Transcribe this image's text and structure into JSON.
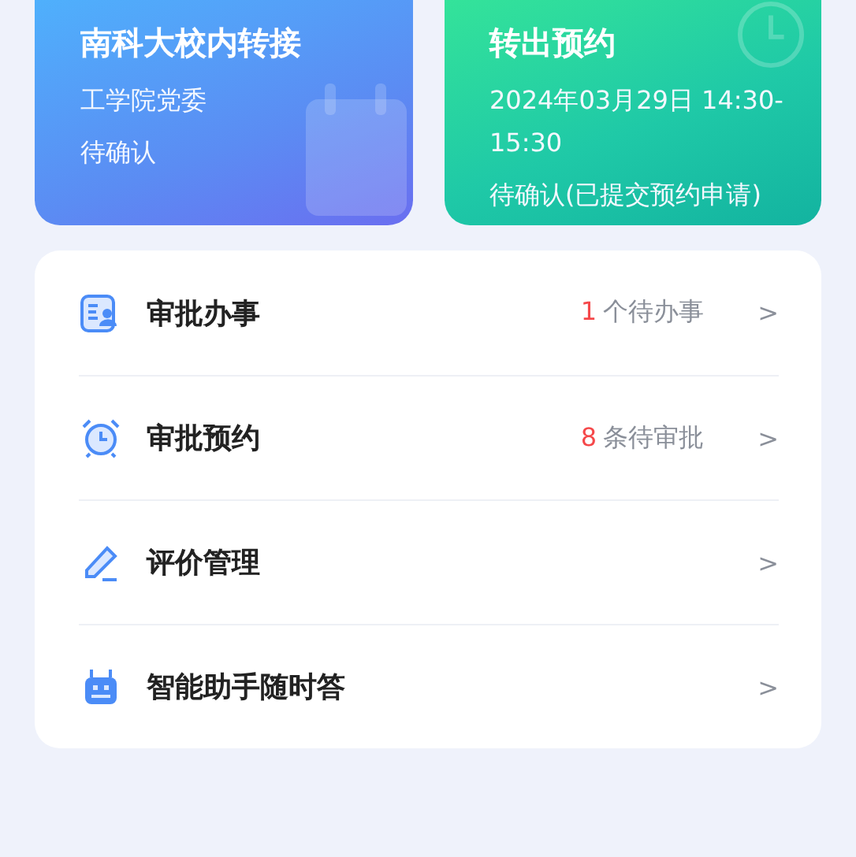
{
  "cards": [
    {
      "kind": "transfer",
      "title": "南科大校内转接",
      "lines": [
        "工学院党委",
        "待确认"
      ]
    },
    {
      "kind": "appointment",
      "title": "转出预约",
      "lines": [
        "2024年03月29日 14:30-15:30",
        "待确认(已提交预约申请)"
      ]
    }
  ],
  "menu": [
    {
      "label": "审批办事",
      "count": "1",
      "count_label": "个待办事",
      "arrow": ">"
    },
    {
      "label": "审批预约",
      "count": "8",
      "count_label": "条待审批",
      "arrow": ">"
    },
    {
      "label": "评价管理",
      "arrow": ">"
    },
    {
      "label": "智能助手随时答",
      "arrow": ">"
    }
  ]
}
